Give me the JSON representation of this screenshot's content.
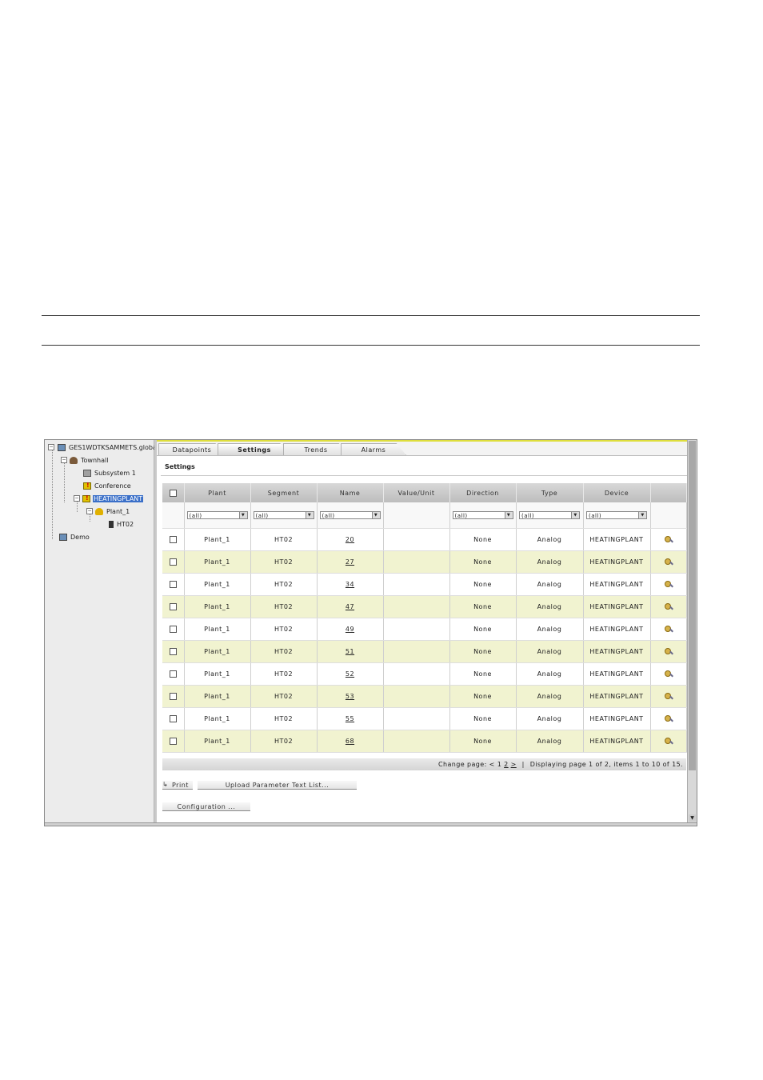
{
  "tree": {
    "root": "GES1WDTKSAMMETS.globa",
    "townhall": "Townhall",
    "subsystem": "Subsystem 1",
    "conference": "Conference",
    "heatingplant": "HEATINGPLANT",
    "plant": "Plant_1",
    "ht02": "HT02",
    "demo": "Demo"
  },
  "tabs": [
    "Datapoints",
    "Settings",
    "Trends",
    "Alarms"
  ],
  "panel_title": "Settings",
  "columns": [
    "Plant",
    "Segment",
    "Name",
    "Value/Unit",
    "Direction",
    "Type",
    "Device"
  ],
  "filter_value": "(all)",
  "rows": [
    {
      "plant": "Plant_1",
      "segment": "HT02",
      "name": "20",
      "value": "",
      "direction": "None",
      "type": "Analog",
      "device": "HEATINGPLANT"
    },
    {
      "plant": "Plant_1",
      "segment": "HT02",
      "name": "27",
      "value": "",
      "direction": "None",
      "type": "Analog",
      "device": "HEATINGPLANT"
    },
    {
      "plant": "Plant_1",
      "segment": "HT02",
      "name": "34",
      "value": "",
      "direction": "None",
      "type": "Analog",
      "device": "HEATINGPLANT"
    },
    {
      "plant": "Plant_1",
      "segment": "HT02",
      "name": "47",
      "value": "",
      "direction": "None",
      "type": "Analog",
      "device": "HEATINGPLANT"
    },
    {
      "plant": "Plant_1",
      "segment": "HT02",
      "name": "49",
      "value": "",
      "direction": "None",
      "type": "Analog",
      "device": "HEATINGPLANT"
    },
    {
      "plant": "Plant_1",
      "segment": "HT02",
      "name": "51",
      "value": "",
      "direction": "None",
      "type": "Analog",
      "device": "HEATINGPLANT"
    },
    {
      "plant": "Plant_1",
      "segment": "HT02",
      "name": "52",
      "value": "",
      "direction": "None",
      "type": "Analog",
      "device": "HEATINGPLANT"
    },
    {
      "plant": "Plant_1",
      "segment": "HT02",
      "name": "53",
      "value": "",
      "direction": "None",
      "type": "Analog",
      "device": "HEATINGPLANT"
    },
    {
      "plant": "Plant_1",
      "segment": "HT02",
      "name": "55",
      "value": "",
      "direction": "None",
      "type": "Analog",
      "device": "HEATINGPLANT"
    },
    {
      "plant": "Plant_1",
      "segment": "HT02",
      "name": "68",
      "value": "",
      "direction": "None",
      "type": "Analog",
      "device": "HEATINGPLANT"
    }
  ],
  "pager": {
    "change_page": "Change page:",
    "prev": "<",
    "page1": "1",
    "page2": "2",
    "next": ">",
    "separator": "|",
    "info": "Displaying page 1 of 2, items 1 to 10 of 15."
  },
  "buttons": {
    "print": "Print",
    "upload": "Upload Parameter Text List...",
    "configuration": "Configuration ..."
  },
  "colors": {
    "row_alt": "#f1f3d0",
    "accent_yellow": "#dede3c",
    "selection": "#3a6fc8"
  }
}
